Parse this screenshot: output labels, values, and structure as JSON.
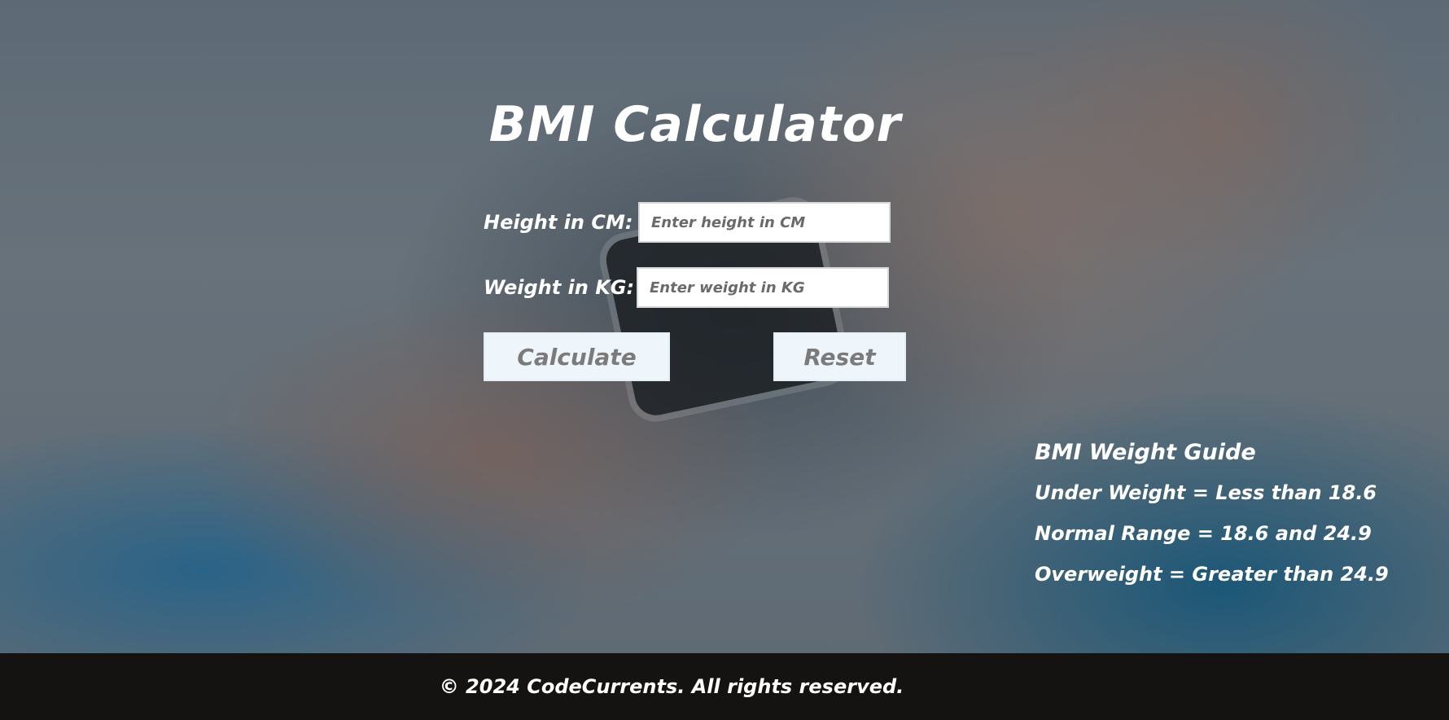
{
  "page": {
    "title": "BMI Calculator"
  },
  "form": {
    "height_label": "Height in CM:",
    "height_placeholder": "Enter height in CM",
    "height_value": "",
    "weight_label": "Weight in KG:",
    "weight_placeholder": "Enter weight in KG",
    "weight_value": ""
  },
  "buttons": {
    "calculate_label": "Calculate",
    "reset_label": "Reset"
  },
  "guide": {
    "title": "BMI Weight Guide",
    "items": [
      "Under Weight = Less than 18.6",
      "Normal Range = 18.6 and 24.9",
      "Overweight = Greater than 24.9"
    ]
  },
  "footer": {
    "text": "© 2024 CodeCurrents. All rights reserved."
  },
  "colors": {
    "footer_bg": "#141312",
    "button_bg": "#eef6fc",
    "button_text": "#7b7b7b",
    "text": "#ffffff"
  }
}
